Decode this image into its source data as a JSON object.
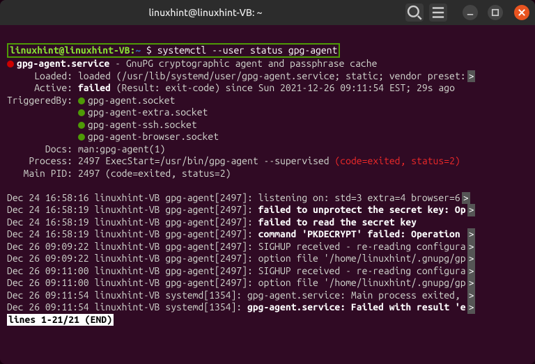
{
  "titlebar": {
    "title": "linuxhint@linuxhint-VB: ~"
  },
  "prompt": {
    "userhost": "linuxhint@linuxhint-VB",
    "path": "~",
    "sep": ":",
    "dollar": "$",
    "command": "systemctl --user status gpg-agent"
  },
  "status": {
    "unit": "gpg-agent.service",
    "desc": "GnuPG cryptographic agent and passphrase cache",
    "loaded_label": "Loaded:",
    "loaded": "loaded (/usr/lib/systemd/user/gpg-agent.service; static; vendor preset:",
    "active_label": "Active:",
    "active_state": "failed",
    "active_rest": "(Result: exit-code) since Sun 2021-12-26 09:11:54 EST; 29s ago",
    "triggered_label": "TriggeredBy:",
    "triggers": [
      "gpg-agent.socket",
      "gpg-agent-extra.socket",
      "gpg-agent-ssh.socket",
      "gpg-agent-browser.socket"
    ],
    "docs_label": "Docs:",
    "docs": "man:gpg-agent(1)",
    "process_label": "Process:",
    "process": "2497 ExecStart=/usr/bin/gpg-agent --supervised",
    "process_fail": "(code=exited, status=2)",
    "mainpid_label": "Main PID:",
    "mainpid": "2497 (code=exited, status=2)"
  },
  "logs": [
    {
      "t": "Dec 24 16:58:16",
      "h": "linuxhint-VB",
      "u": "gpg-agent[2497]:",
      "m": "listening on: std=3 extra=4 browser=6",
      "more": ">"
    },
    {
      "t": "Dec 24 16:58:19",
      "h": "linuxhint-VB",
      "u": "gpg-agent[2497]:",
      "m": "failed to unprotect the secret key: Op",
      "more": ">",
      "bold": true
    },
    {
      "t": "Dec 24 16:58:19",
      "h": "linuxhint-VB",
      "u": "gpg-agent[2497]:",
      "m": "failed to read the secret key",
      "bold": true
    },
    {
      "t": "Dec 24 16:58:19",
      "h": "linuxhint-VB",
      "u": "gpg-agent[2497]:",
      "m": "command 'PKDECRYPT' failed: Operation ",
      "more": ">",
      "bold": true
    },
    {
      "t": "Dec 26 09:09:22",
      "h": "linuxhint-VB",
      "u": "gpg-agent[2497]:",
      "m": "SIGHUP received - re-reading configura",
      "more": ">"
    },
    {
      "t": "Dec 26 09:09:22",
      "h": "linuxhint-VB",
      "u": "gpg-agent[2497]:",
      "m": "option file '/home/linuxhint/.gnupg/gp",
      "more": ">"
    },
    {
      "t": "Dec 26 09:11:00",
      "h": "linuxhint-VB",
      "u": "gpg-agent[2497]:",
      "m": "SIGHUP received - re-reading configura",
      "more": ">"
    },
    {
      "t": "Dec 26 09:11:00",
      "h": "linuxhint-VB",
      "u": "gpg-agent[2497]:",
      "m": "option file '/home/linuxhint/.gnupg/gp",
      "more": ">"
    },
    {
      "t": "Dec 26 09:11:54",
      "h": "linuxhint-VB",
      "u": "systemd[1354]:",
      "m": "gpg-agent.service: Main process exited, ",
      "more": ">"
    },
    {
      "t": "Dec 26 09:11:54",
      "h": "linuxhint-VB",
      "u": "systemd[1354]:",
      "m": "gpg-agent.service: Failed with result 'e",
      "more": ">",
      "yellow": true
    }
  ],
  "pager": {
    "status": "lines 1-21/21 (END)"
  }
}
